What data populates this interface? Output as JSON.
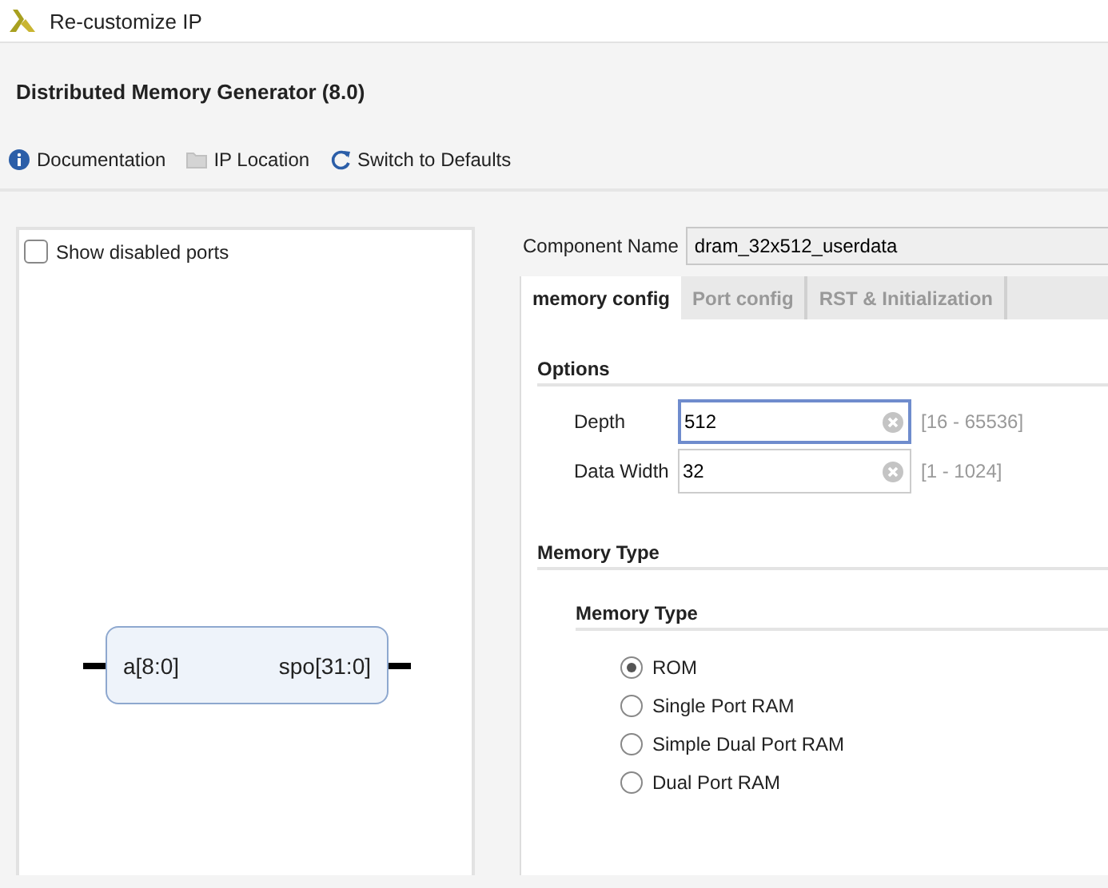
{
  "window": {
    "title": "Re-customize IP"
  },
  "header": {
    "title": "Distributed Memory Generator (8.0)"
  },
  "toolbar": [
    {
      "label": "Documentation",
      "kind": "info"
    },
    {
      "label": "IP Location",
      "kind": "folder"
    },
    {
      "label": "Switch to Defaults",
      "kind": "refresh"
    }
  ],
  "symbol_panel": {
    "show_disabled_ports": {
      "label": "Show disabled ports",
      "checked": false
    },
    "block": {
      "input": "a[8:0]",
      "output": "spo[31:0]"
    }
  },
  "component_name": {
    "label": "Component Name",
    "value": "dram_32x512_userdata"
  },
  "tabs": [
    {
      "label": "memory config",
      "selected": true
    },
    {
      "label": "Port config",
      "selected": false
    },
    {
      "label": "RST & Initialization",
      "selected": false
    }
  ],
  "options": {
    "title": "Options",
    "fields": [
      {
        "label": "Depth",
        "value": "512",
        "range": "[16 - 65536]",
        "focused": true
      },
      {
        "label": "Data Width",
        "value": "32",
        "range": "[1 - 1024]",
        "focused": false
      }
    ]
  },
  "memory_type": {
    "title": "Memory Type",
    "group_title": "Memory Type",
    "options": [
      {
        "label": "ROM",
        "selected": true
      },
      {
        "label": "Single Port RAM",
        "selected": false
      },
      {
        "label": "Simple Dual Port RAM",
        "selected": false
      },
      {
        "label": "Dual Port RAM",
        "selected": false
      }
    ]
  }
}
